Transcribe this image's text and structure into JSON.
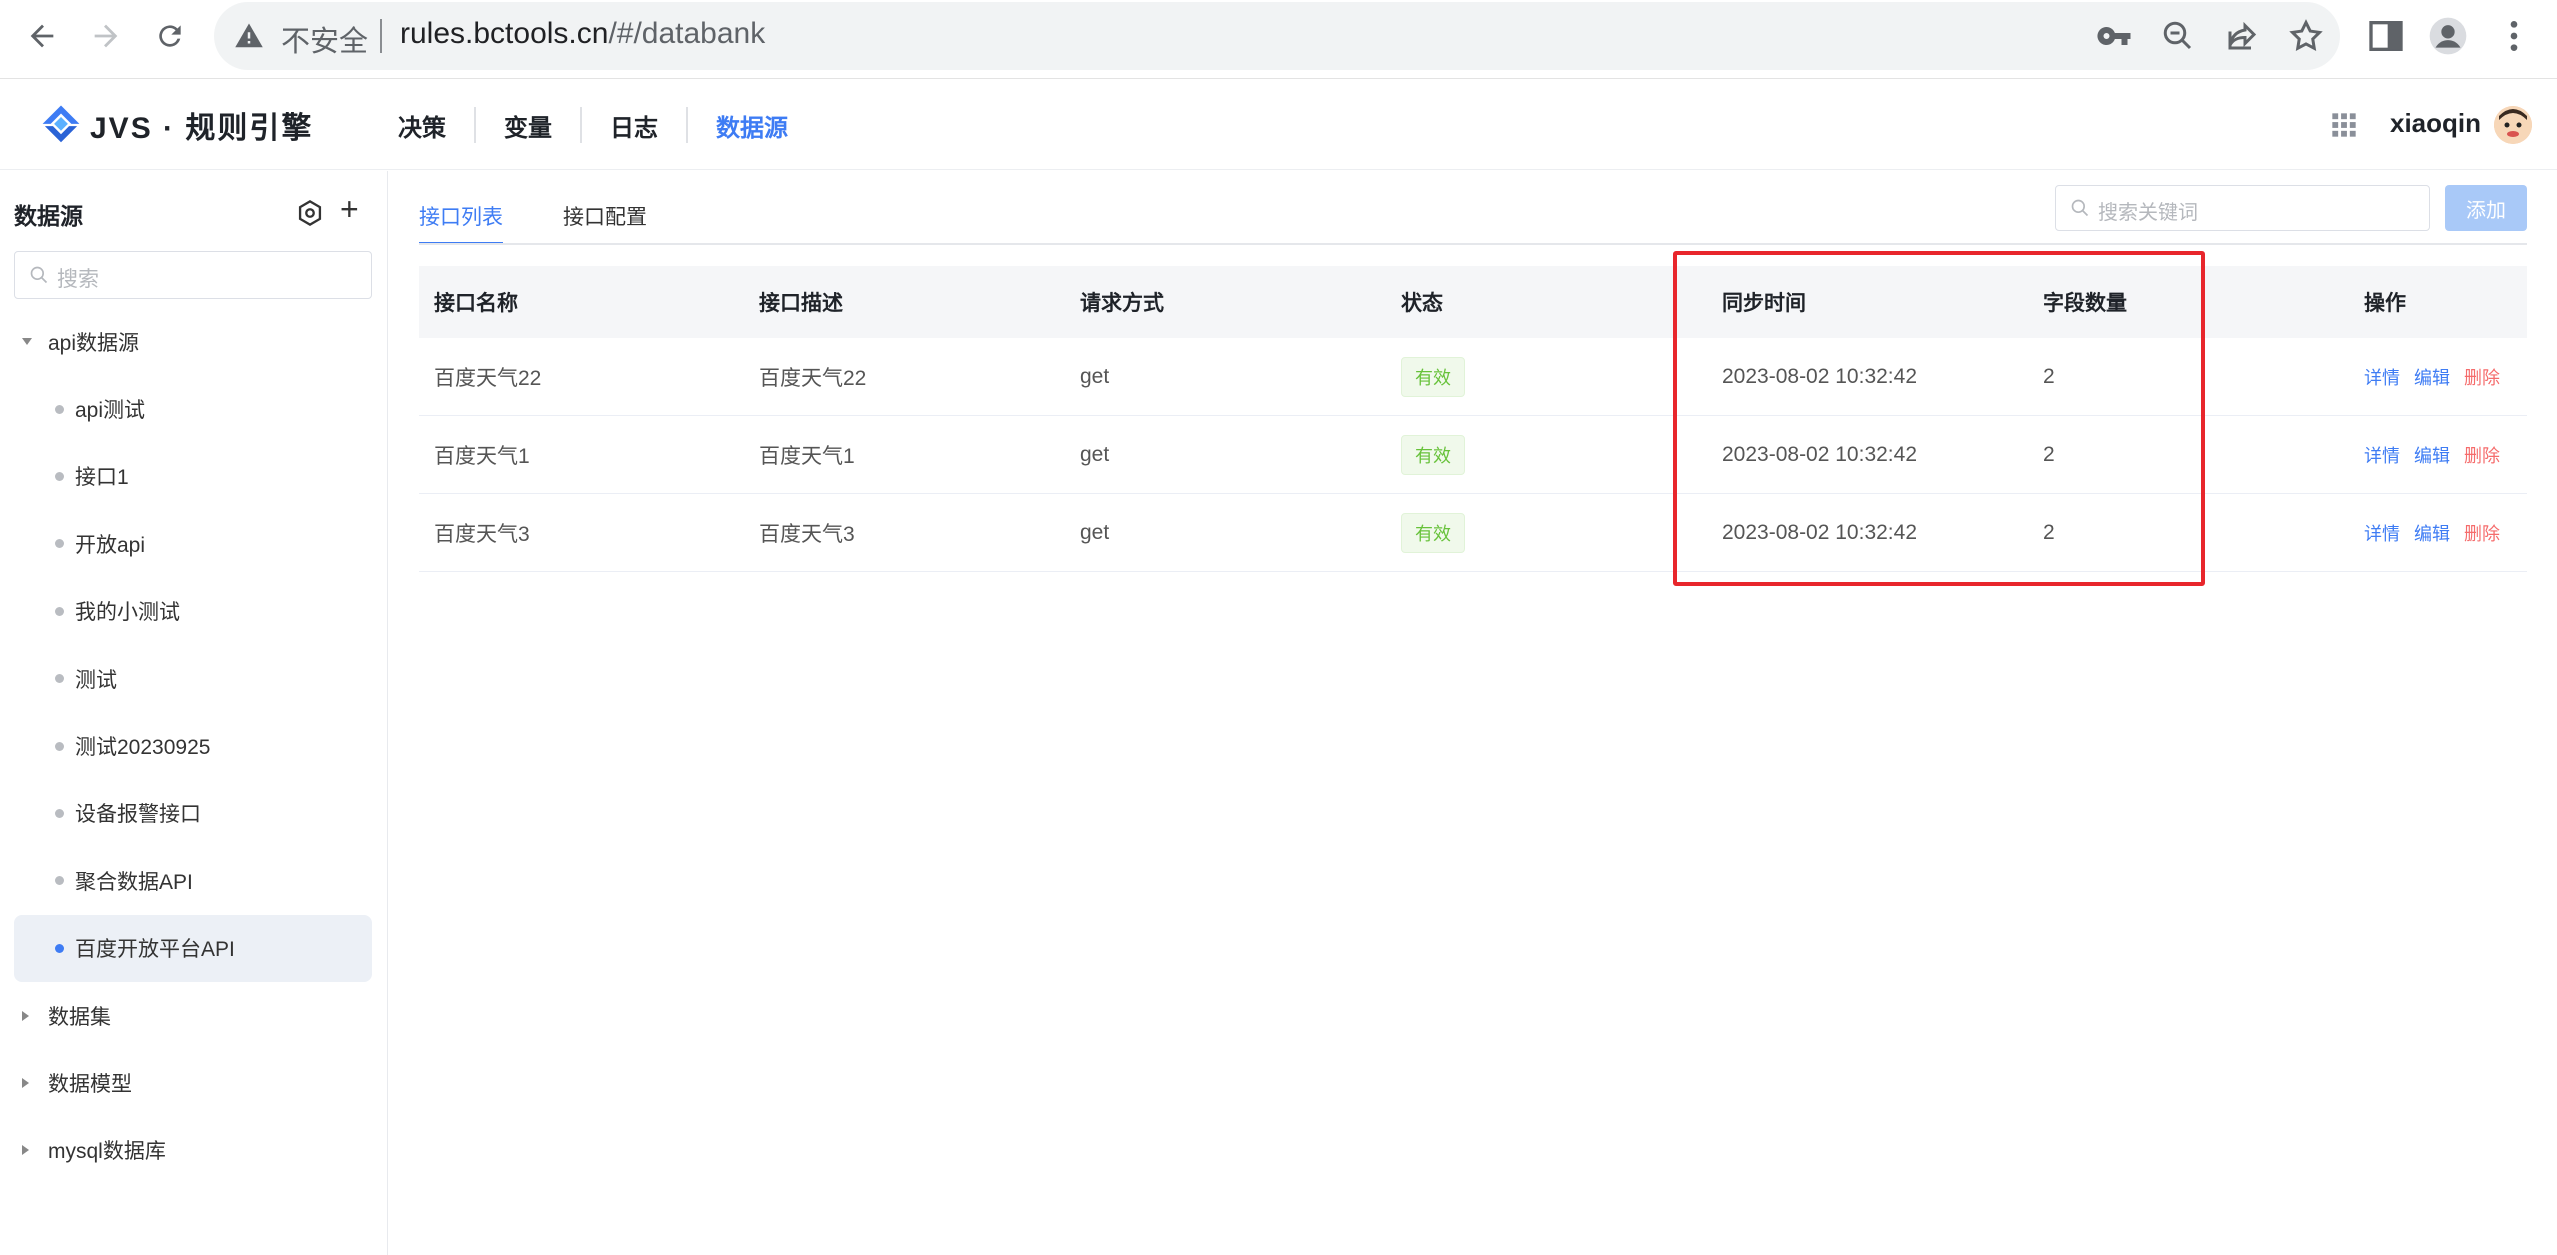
{
  "browser": {
    "security_label": "不安全",
    "url_host": "rules.bctools.cn",
    "url_path": "/#/databank"
  },
  "app": {
    "logo_text": "JVS · 规则引擎",
    "nav": [
      {
        "label": "决策"
      },
      {
        "label": "变量"
      },
      {
        "label": "日志"
      },
      {
        "label": "数据源"
      }
    ],
    "username": "xiaoqin"
  },
  "sidebar": {
    "title": "数据源",
    "search_placeholder": "搜索",
    "groups": [
      {
        "label": "api数据源"
      },
      {
        "label": "数据集"
      },
      {
        "label": "数据模型"
      },
      {
        "label": "mysql数据库"
      }
    ],
    "api_children": [
      {
        "label": "api测试"
      },
      {
        "label": "接口1"
      },
      {
        "label": "开放api"
      },
      {
        "label": "我的小测试"
      },
      {
        "label": "测试"
      },
      {
        "label": "测试20230925"
      },
      {
        "label": "设备报警接口"
      },
      {
        "label": "聚合数据API"
      },
      {
        "label": "百度开放平台API"
      }
    ]
  },
  "main": {
    "tabs": [
      {
        "label": "接口列表"
      },
      {
        "label": "接口配置"
      }
    ],
    "search_placeholder": "搜索关键词",
    "add_label": "添加",
    "columns": [
      "接口名称",
      "接口描述",
      "请求方式",
      "状态",
      "同步时间",
      "字段数量",
      "操作"
    ],
    "rows": [
      {
        "name": "百度天气22",
        "desc": "百度天气22",
        "method": "get",
        "status": "有效",
        "sync_time": "2023-08-02 10:32:42",
        "field_count": "2"
      },
      {
        "name": "百度天气1",
        "desc": "百度天气1",
        "method": "get",
        "status": "有效",
        "sync_time": "2023-08-02 10:32:42",
        "field_count": "2"
      },
      {
        "name": "百度天气3",
        "desc": "百度天气3",
        "method": "get",
        "status": "有效",
        "sync_time": "2023-08-02 10:32:42",
        "field_count": "2"
      }
    ],
    "actions": {
      "detail": "详情",
      "edit": "编辑",
      "delete": "删除"
    }
  },
  "colors": {
    "accent": "#3e7cf4",
    "success": "#67c23a",
    "danger": "#f56c6c",
    "highlight": "#e8262c"
  }
}
